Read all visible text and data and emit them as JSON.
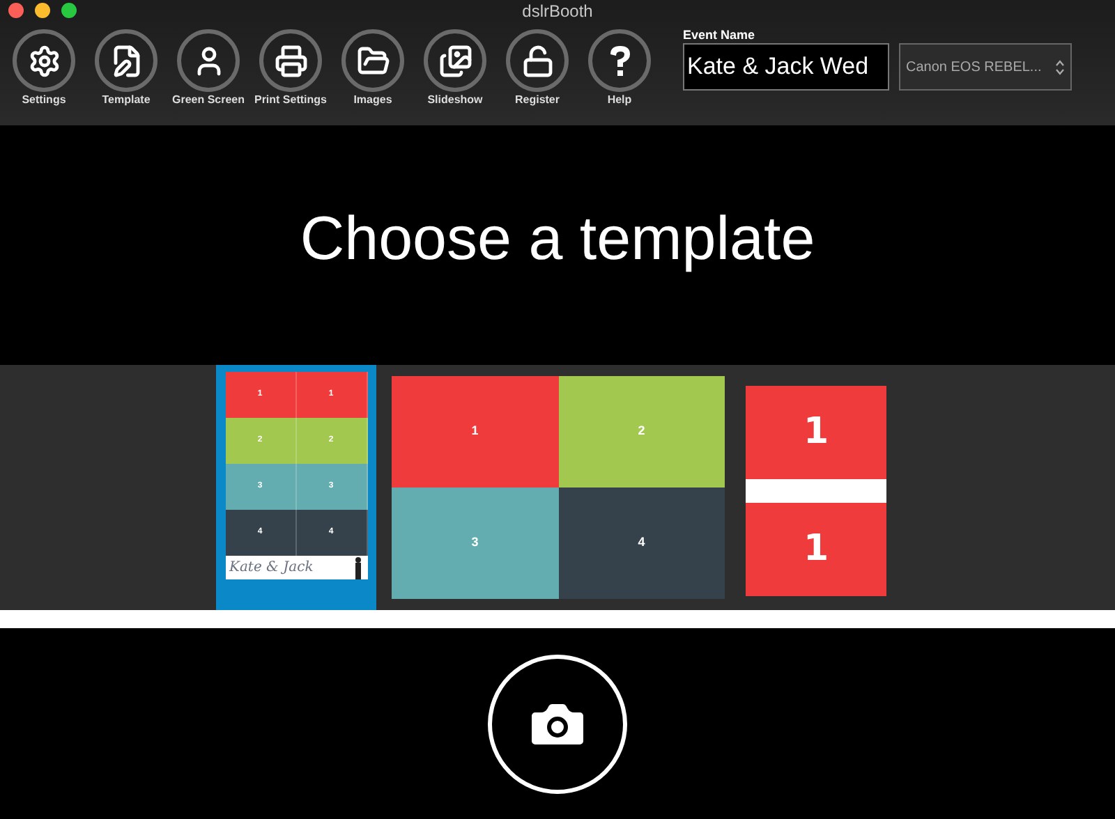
{
  "window": {
    "title": "dslrBooth"
  },
  "toolbar": [
    {
      "kind": "settings",
      "label": "Settings"
    },
    {
      "kind": "template",
      "label": "Template"
    },
    {
      "kind": "person",
      "label": "Green Screen"
    },
    {
      "kind": "printer",
      "label": "Print Settings"
    },
    {
      "kind": "folder",
      "label": "Images"
    },
    {
      "kind": "images",
      "label": "Slideshow"
    },
    {
      "kind": "unlock",
      "label": "Register"
    },
    {
      "kind": "help",
      "label": "Help"
    }
  ],
  "event": {
    "label": "Event Name",
    "value": "Kate & Jack Wed"
  },
  "camera_select": {
    "value": "Canon EOS REBEL..."
  },
  "heading": "Choose a template",
  "templates": [
    {
      "kind": "strip",
      "selected": true,
      "caption": "Kate & Jack",
      "cells": [
        {
          "label": "1",
          "color": "#ef3b3b"
        },
        {
          "label": "1",
          "color": "#ef3b3b"
        },
        {
          "label": "2",
          "color": "#a2c850"
        },
        {
          "label": "2",
          "color": "#a2c850"
        },
        {
          "label": "3",
          "color": "#63adb0"
        },
        {
          "label": "3",
          "color": "#63adb0"
        },
        {
          "label": "4",
          "color": "#35424b"
        },
        {
          "label": "4",
          "color": "#35424b"
        }
      ]
    },
    {
      "kind": "grid",
      "selected": false,
      "cells": [
        {
          "label": "1",
          "color": "#ef3b3b"
        },
        {
          "label": "2",
          "color": "#a2c850"
        },
        {
          "label": "3",
          "color": "#63adb0"
        },
        {
          "label": "4",
          "color": "#35424b"
        }
      ]
    },
    {
      "kind": "stack",
      "selected": false,
      "cells": [
        {
          "label": "1",
          "color": "#ef3b3b"
        },
        {
          "label": "1",
          "color": "#ef3b3b"
        }
      ]
    }
  ]
}
